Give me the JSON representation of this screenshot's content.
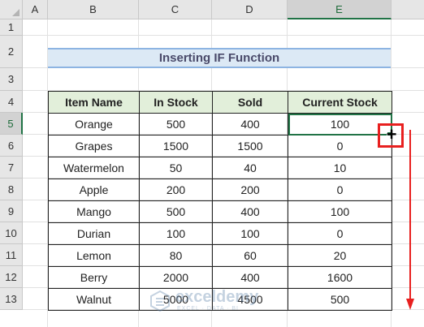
{
  "sheet": {
    "columns": [
      "A",
      "B",
      "C",
      "D",
      "E"
    ],
    "selected_column": "E",
    "rows": [
      "1",
      "2",
      "3",
      "4",
      "5",
      "6",
      "7",
      "8",
      "9",
      "10",
      "11",
      "12",
      "13"
    ],
    "selected_row": "5"
  },
  "title": "Inserting IF Function",
  "table": {
    "headers": [
      "Item Name",
      "In Stock",
      "Sold",
      "Current Stock"
    ],
    "rows": [
      [
        "Orange",
        "500",
        "400",
        "100"
      ],
      [
        "Grapes",
        "1500",
        "1500",
        "0"
      ],
      [
        "Watermelon",
        "50",
        "40",
        "10"
      ],
      [
        "Apple",
        "200",
        "200",
        "0"
      ],
      [
        "Mango",
        "500",
        "400",
        "100"
      ],
      [
        "Durian",
        "100",
        "100",
        "0"
      ],
      [
        "Lemon",
        "80",
        "60",
        "20"
      ],
      [
        "Berry",
        "2000",
        "400",
        "1600"
      ],
      [
        "Walnut",
        "5000",
        "4500",
        "500"
      ]
    ]
  },
  "active_cell": "E5",
  "annotation": {
    "cursor": "+",
    "color": "#e8201f"
  },
  "watermark": {
    "name": "exceldemy",
    "tagline": "EXCEL · DATA · BI"
  },
  "colors": {
    "header_fill": "#e2efda",
    "title_fill": "#dce9f5",
    "accent": "#217346"
  }
}
